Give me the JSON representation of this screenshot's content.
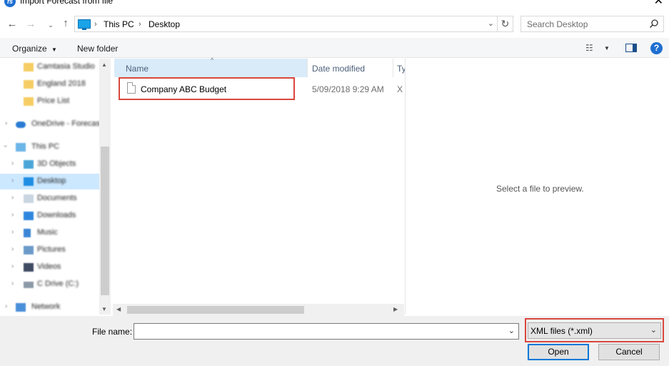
{
  "window": {
    "title": "Import Forecast from file",
    "app_icon_letter": "fs"
  },
  "address_bar": {
    "breadcrumbs": [
      "This PC",
      "Desktop"
    ]
  },
  "search": {
    "placeholder": "Search Desktop"
  },
  "toolbar": {
    "organize_label": "Organize",
    "new_folder_label": "New folder",
    "help_label": "?"
  },
  "nav_pane": {
    "items": [
      {
        "label": "Camtasia Studio",
        "icon": "folder-icon"
      },
      {
        "label": "England 2018",
        "icon": "folder-icon"
      },
      {
        "label": "Price List",
        "icon": "folder-icon"
      },
      {
        "label": "OneDrive - Forecast",
        "icon": "cloud-icon"
      },
      {
        "label": "This PC",
        "icon": "pc-icon"
      },
      {
        "label": "3D Objects",
        "icon": "cube-icon"
      },
      {
        "label": "Desktop",
        "icon": "desktop-icon",
        "selected": true
      },
      {
        "label": "Documents",
        "icon": "documents-icon"
      },
      {
        "label": "Downloads",
        "icon": "download-icon"
      },
      {
        "label": "Music",
        "icon": "music-icon"
      },
      {
        "label": "Pictures",
        "icon": "pictures-icon"
      },
      {
        "label": "Videos",
        "icon": "videos-icon"
      },
      {
        "label": "C Drive (C:)",
        "icon": "drive-icon"
      },
      {
        "label": "Network",
        "icon": "network-icon"
      }
    ]
  },
  "file_list": {
    "columns": [
      "Name",
      "Date modified",
      "Ty"
    ],
    "rows": [
      {
        "name": "Company ABC Budget",
        "date_modified": "5/09/2018 9:29 AM",
        "type": "X"
      }
    ]
  },
  "preview": {
    "message": "Select a file to preview."
  },
  "bottom": {
    "file_name_label": "File name:",
    "file_name_value": "",
    "file_type_selected": "XML files (*.xml)",
    "open_label": "Open",
    "cancel_label": "Cancel"
  },
  "colors": {
    "highlight_border": "#d9473d",
    "selection_bg": "#cce8ff",
    "primary_button_border": "#0078d7"
  }
}
